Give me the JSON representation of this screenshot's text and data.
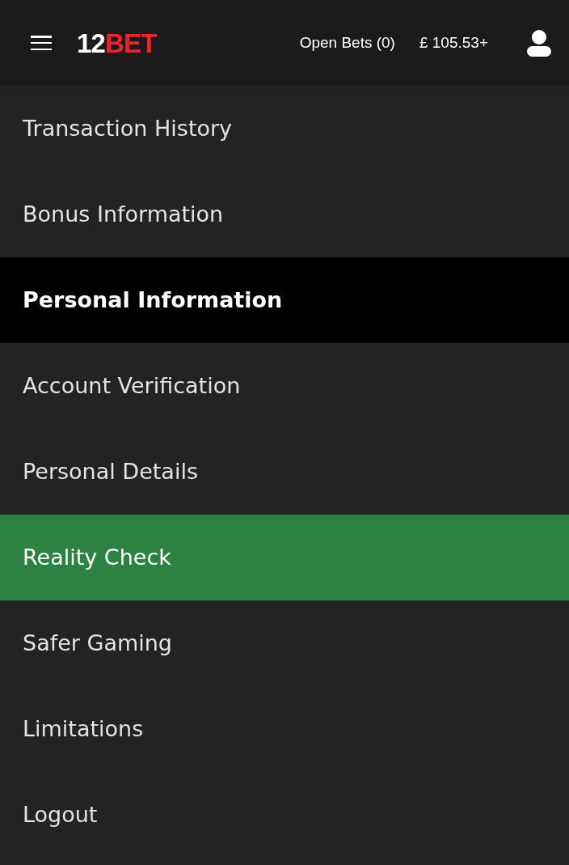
{
  "header": {
    "logo": {
      "part_1": "12",
      "part_2": "BET"
    },
    "open_bets": "Open Bets (0)",
    "balance": "£ 105.53+"
  },
  "menu": [
    {
      "kind": "item",
      "label": "Transaction History",
      "selected": false
    },
    {
      "kind": "item",
      "label": "Bonus Information",
      "selected": false
    },
    {
      "kind": "heading",
      "label": "Personal Information"
    },
    {
      "kind": "item",
      "label": "Account Verification",
      "selected": false
    },
    {
      "kind": "item",
      "label": "Personal Details",
      "selected": false
    },
    {
      "kind": "item",
      "label": "Reality Check",
      "selected": true
    },
    {
      "kind": "item",
      "label": "Safer Gaming",
      "selected": false
    },
    {
      "kind": "item",
      "label": "Limitations",
      "selected": false
    },
    {
      "kind": "item",
      "label": "Logout",
      "selected": false
    }
  ]
}
